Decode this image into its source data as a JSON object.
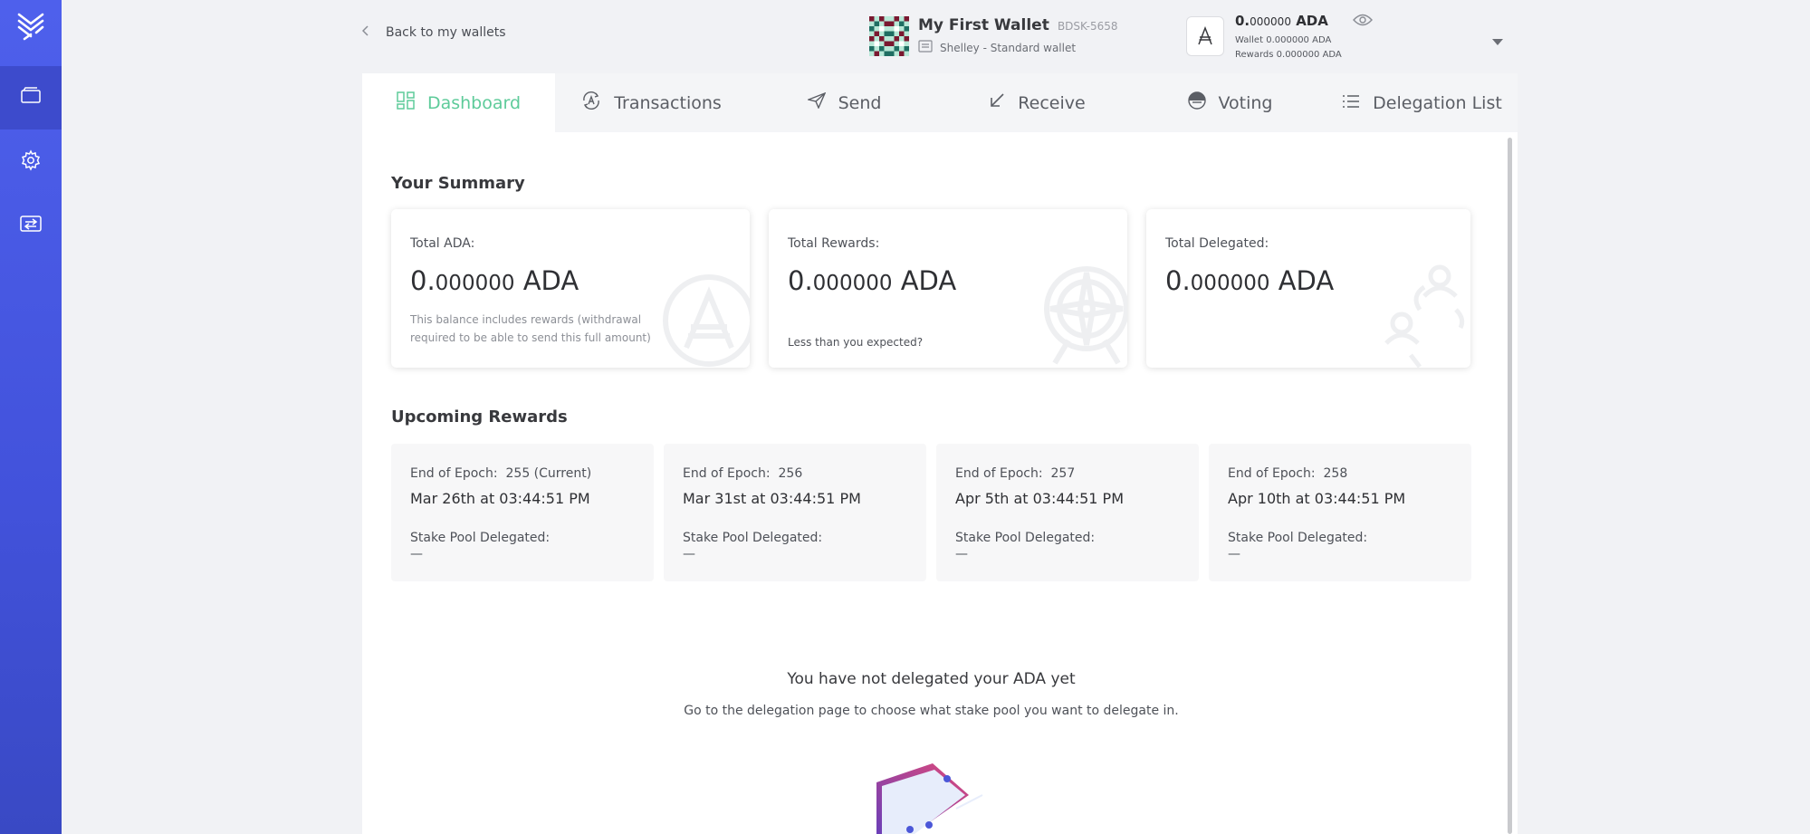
{
  "sidebar": {
    "logo_icon": "yoroi-logo-icon",
    "items": [
      {
        "name": "wallets",
        "icon": "wallet-icon",
        "active": true
      },
      {
        "name": "settings",
        "icon": "gear-icon",
        "active": false
      },
      {
        "name": "transfer",
        "icon": "transfer-icon",
        "active": false
      }
    ]
  },
  "header": {
    "back_label": "Back to my wallets",
    "wallet_name": "My First Wallet",
    "wallet_code": "BDSK-5658",
    "wallet_type": "Shelley - Standard wallet",
    "balance_int": "0.",
    "balance_dec": "000000",
    "balance_unit": "ADA",
    "wallet_label": "Wallet",
    "wallet_int": "0.",
    "wallet_dec": "000000",
    "wallet_unit": "ADA",
    "rewards_label": "Rewards",
    "rewards_int": "0.",
    "rewards_dec": "000000",
    "rewards_unit": "ADA"
  },
  "tabs": [
    {
      "label": "Dashboard",
      "icon": "dashboard-icon",
      "active": true
    },
    {
      "label": "Transactions",
      "icon": "transactions-icon",
      "active": false
    },
    {
      "label": "Send",
      "icon": "send-icon",
      "active": false
    },
    {
      "label": "Receive",
      "icon": "receive-icon",
      "active": false
    },
    {
      "label": "Voting",
      "icon": "voting-icon",
      "active": false
    },
    {
      "label": "Delegation List",
      "icon": "list-icon",
      "active": false
    }
  ],
  "summary": {
    "title": "Your Summary",
    "cards": [
      {
        "label": "Total ADA:",
        "int": "0.",
        "dec": "000000",
        "unit": "ADA",
        "note": "This balance includes rewards (withdrawal required to be able to send this full amount)"
      },
      {
        "label": "Total Rewards:",
        "int": "0.",
        "dec": "000000",
        "unit": "ADA",
        "link": "Less than you expected?"
      },
      {
        "label": "Total Delegated:",
        "int": "0.",
        "dec": "000000",
        "unit": "ADA"
      }
    ]
  },
  "upcoming": {
    "title": "Upcoming Rewards",
    "epochs": [
      {
        "label": "End of Epoch:",
        "epoch": "255 (Current)",
        "date": "Mar 26th at 03:44:51 PM",
        "pool_label": "Stake Pool Delegated:",
        "pool": "—"
      },
      {
        "label": "End of Epoch:",
        "epoch": "256",
        "date": "Mar 31st at 03:44:51 PM",
        "pool_label": "Stake Pool Delegated:",
        "pool": "—"
      },
      {
        "label": "End of Epoch:",
        "epoch": "257",
        "date": "Apr 5th at 03:44:51 PM",
        "pool_label": "Stake Pool Delegated:",
        "pool": "—"
      },
      {
        "label": "End of Epoch:",
        "epoch": "258",
        "date": "Apr 10th at 03:44:51 PM",
        "pool_label": "Stake Pool Delegated:",
        "pool": "—"
      }
    ]
  },
  "no_delegation": {
    "title": "You have not delegated your ADA yet",
    "text": "Go to the delegation page to choose what stake pool you want to delegate in."
  },
  "colors": {
    "accent": "#5ecb9a",
    "sidebar": "#4e60ec"
  }
}
